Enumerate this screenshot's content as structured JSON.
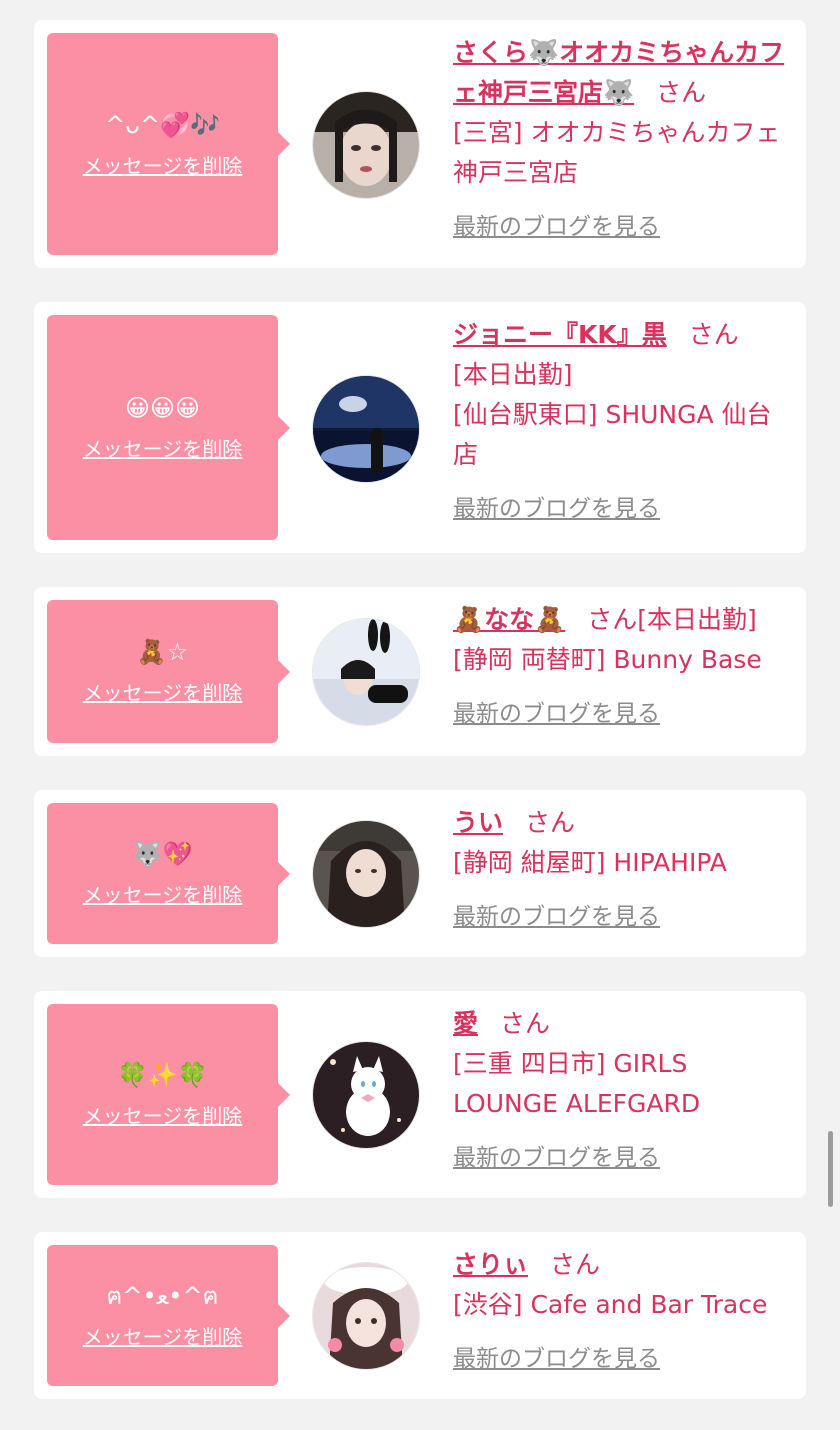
{
  "ui": {
    "delete_label": "メッセージを削除",
    "honorific": "さん",
    "blog_label": "最新のブログを見る"
  },
  "colors": {
    "bubble": "#fb8fa3",
    "accent": "#d9325e",
    "link_gray": "#8c8c8c",
    "background": "#f2f2f2"
  },
  "cards": [
    {
      "message": "^ᴗ^💞🎶",
      "name": "さくら🐺オオカミちゃんカフェ神戸三宮店🐺",
      "tags": "",
      "shop": "[三宮] オオカミちゃんカフェ神戸三宮店"
    },
    {
      "message": "😀😀😀",
      "name": "ジョニー『KK』黒",
      "tags": "[本日出勤]",
      "shop": "[仙台駅東口] SHUNGA 仙台店"
    },
    {
      "message": "🧸☆",
      "name": "🧸なな🧸",
      "tags": "[本日出勤]",
      "shop": "[静岡 両替町] Bunny Base"
    },
    {
      "message": "🐺💖",
      "name": "うい",
      "tags": "",
      "shop": "[静岡 紺屋町] HIPAHIPA"
    },
    {
      "message": "🍀✨🍀",
      "name": "愛",
      "tags": "",
      "shop": "[三重 四日市] GIRLS LOUNGE ALEFGARD"
    },
    {
      "message": "ฅ^•ﻌ•^ฅ",
      "name": "さりぃ",
      "tags": "",
      "shop": "[渋谷] Cafe and Bar Trace"
    }
  ]
}
